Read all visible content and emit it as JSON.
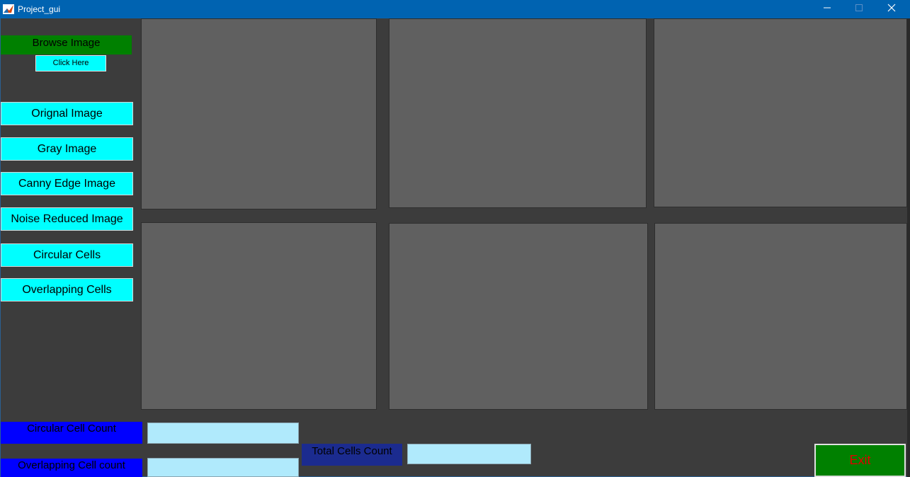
{
  "window": {
    "title": "Project_gui",
    "icon": "matlab-icon",
    "title_bar_color": "#0063b1"
  },
  "sidebar": {
    "browse_label": "Browse Image",
    "click_here": "Click Here",
    "buttons": [
      "Orignal Image",
      "Gray Image",
      "Canny Edge Image",
      "Noise Reduced Image",
      "Circular Cells",
      "Overlapping Cells"
    ]
  },
  "counts": {
    "circular_label": "Circular Cell Count",
    "circular_value": "",
    "overlapping_label": "Overlapping Cell count",
    "overlapping_value": "",
    "total_label": "Total Cells Count",
    "total_value": ""
  },
  "exit_label": "Exit",
  "colors": {
    "background": "#3c3c3c",
    "button": "#00ffff",
    "browse_label_bg": "#008000",
    "count_label_bg": "#0000ff",
    "total_label_bg": "#1b2b8f",
    "field_bg": "#b0eafc",
    "exit_bg": "#008000",
    "exit_text": "#e00000",
    "axes_bg": "#606060"
  }
}
